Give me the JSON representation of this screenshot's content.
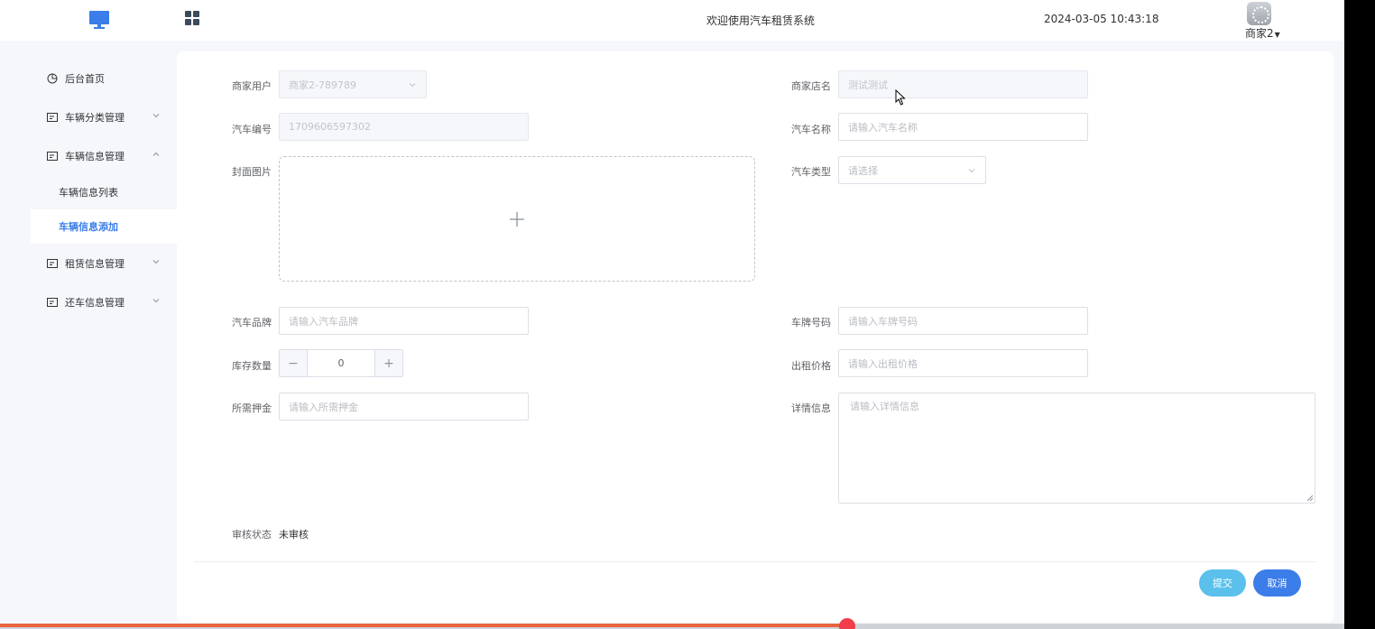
{
  "header": {
    "welcome": "欢迎使用汽车租赁系统",
    "datetime": "2024-03-05 10:43:18",
    "user": "商家2"
  },
  "sidebar": {
    "items": [
      {
        "label": "后台首页"
      },
      {
        "label": "车辆分类管理"
      },
      {
        "label": "车辆信息管理"
      },
      {
        "label": "租赁信息管理"
      },
      {
        "label": "还车信息管理"
      }
    ],
    "subitems": [
      {
        "label": "车辆信息列表"
      },
      {
        "label": "车辆信息添加"
      }
    ]
  },
  "form": {
    "merchant_user": {
      "label": "商家用户",
      "value": "商家2-789789"
    },
    "shop_name": {
      "label": "商家店名",
      "value": "测试测试"
    },
    "car_no": {
      "label": "汽车编号",
      "value": "1709606597302"
    },
    "car_name": {
      "label": "汽车名称",
      "placeholder": "请输入汽车名称"
    },
    "cover": {
      "label": "封面图片"
    },
    "car_type": {
      "label": "汽车类型",
      "placeholder": "请选择"
    },
    "brand": {
      "label": "汽车品牌",
      "placeholder": "请输入汽车品牌"
    },
    "plate": {
      "label": "车牌号码",
      "placeholder": "请输入车牌号码"
    },
    "stock": {
      "label": "库存数量",
      "value": "0",
      "minus": "−",
      "plus": "+"
    },
    "price": {
      "label": "出租价格",
      "placeholder": "请输入出租价格"
    },
    "deposit": {
      "label": "所需押金",
      "placeholder": "请输入所需押金"
    },
    "detail": {
      "label": "详情信息",
      "placeholder": "请输入详情信息"
    },
    "audit": {
      "label": "审核状态",
      "value": "未审核"
    }
  },
  "buttons": {
    "submit": "提交",
    "cancel": "取消"
  },
  "colors": {
    "primary": "#3b7de9",
    "submit": "#5bc0eb",
    "progress": "#e8633e"
  },
  "playback": {
    "progress_fraction": 0.63
  }
}
